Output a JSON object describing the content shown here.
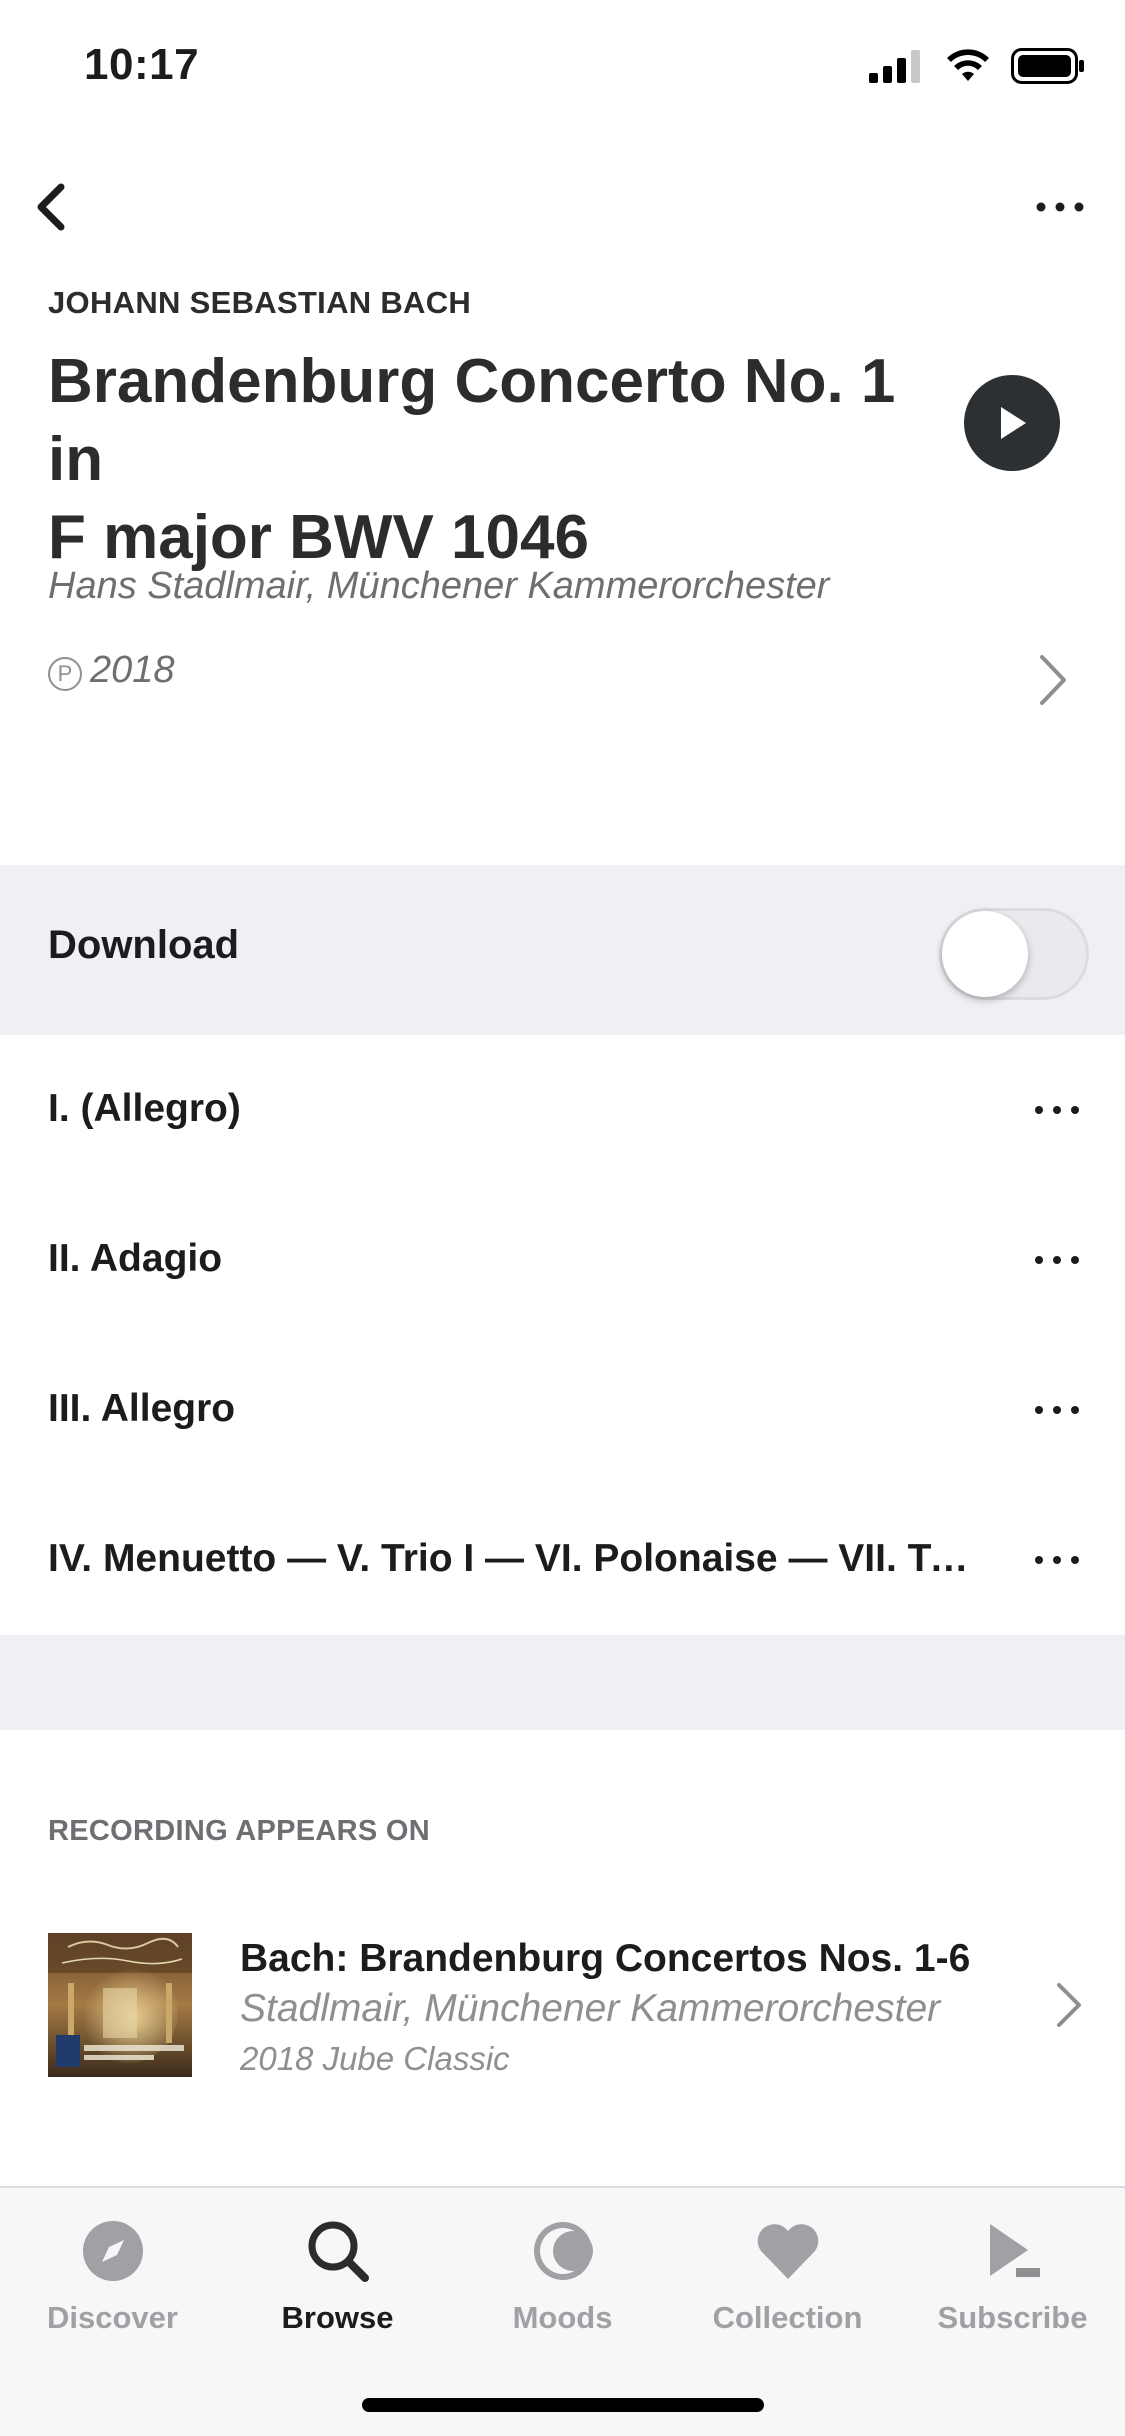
{
  "status_bar": {
    "time": "10:17"
  },
  "header": {
    "composer": "JOHANN SEBASTIAN BACH",
    "title_line1": "Brandenburg Concerto No. 1 in",
    "title_line2": "F major BWV 1046",
    "performers": "Hans Stadlmair, Münchener Kammerorchester",
    "phonogram_symbol": "P",
    "year": "2018"
  },
  "download": {
    "label": "Download",
    "enabled": false
  },
  "tracks": [
    {
      "title": "I. (Allegro)"
    },
    {
      "title": "II. Adagio"
    },
    {
      "title": "III. Allegro"
    },
    {
      "title": "IV. Menuetto — V. Trio I — VI. Polonaise — VII. Trio II"
    }
  ],
  "appears_on": {
    "heading": "RECORDING APPEARS ON",
    "album": {
      "title": "Bach: Brandenburg Concertos Nos. 1-6",
      "artists": "Stadlmair, Münchener Kammerorchester",
      "meta": "2018 Jube Classic"
    }
  },
  "tab_bar": {
    "tabs": [
      {
        "label": "Discover",
        "icon": "compass-icon",
        "active": false
      },
      {
        "label": "Browse",
        "icon": "search-icon",
        "active": true
      },
      {
        "label": "Moods",
        "icon": "moon-icon",
        "active": false
      },
      {
        "label": "Collection",
        "icon": "heart-icon",
        "active": false
      },
      {
        "label": "Subscribe",
        "icon": "subscribe-play-icon",
        "active": false
      }
    ]
  },
  "colors": {
    "text_primary": "#1c1c1e",
    "text_secondary": "#6e6e73",
    "band_background": "#f0f0f4",
    "play_button": "#2d3033",
    "tab_inactive": "#a0a0a5"
  }
}
